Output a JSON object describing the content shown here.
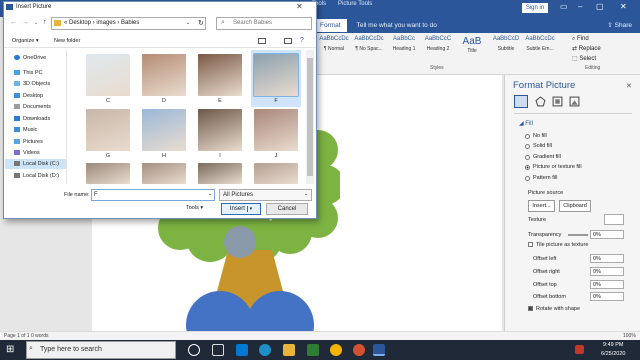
{
  "word": {
    "ribbon_tabs": [
      "Format",
      "Tell me what you want to do"
    ],
    "context_tools": [
      "Tools",
      "Picture Tools"
    ],
    "signin": "Sign in",
    "styles": [
      {
        "sample": "AaBbCcDc",
        "label": "¶ Normal"
      },
      {
        "sample": "AaBbCcDc",
        "label": "¶ No Spac..."
      },
      {
        "sample": "AaBbCc",
        "label": "Heading 1"
      },
      {
        "sample": "AaBbCcC",
        "label": "Heading 2"
      },
      {
        "sample": "AaB",
        "label": "Title"
      },
      {
        "sample": "AaBbCcD",
        "label": "Subtitle"
      },
      {
        "sample": "AaBbCcDc",
        "label": "Subtle Em..."
      }
    ],
    "styles_group": "Styles",
    "editing": [
      "Find",
      "Replace",
      "Select"
    ],
    "editing_group": "Editing",
    "status": "Page 1 of 1    0 words",
    "zoom": "100%"
  },
  "format_pane": {
    "title": "Format Picture",
    "fill_heading": "Fill",
    "fill_options": [
      {
        "label": "No fill",
        "selected": false
      },
      {
        "label": "Solid fill",
        "selected": false
      },
      {
        "label": "Gradient fill",
        "selected": false
      },
      {
        "label": "Picture or texture fill",
        "selected": true
      },
      {
        "label": "Pattern fill",
        "selected": false
      }
    ],
    "picture_source": "Picture source",
    "insert_btn": "Insert...",
    "clipboard_btn": "Clipboard",
    "texture": "Texture",
    "transparency": {
      "label": "Transparency",
      "value": "0%"
    },
    "tile_label": "Tile picture as texture",
    "offsets": [
      {
        "label": "Offset left",
        "value": "0%"
      },
      {
        "label": "Offset right",
        "value": "0%"
      },
      {
        "label": "Offset top",
        "value": "0%"
      },
      {
        "label": "Offset bottom",
        "value": "0%"
      }
    ],
    "rotate_label": "Rotate with shape"
  },
  "dialog": {
    "title": "Insert Picture",
    "breadcrumb": "«  Desktop  ›  images  ›  Babies",
    "search_placeholder": "Search Babies",
    "organize": "Organize ▾",
    "new_folder": "New folder",
    "nav_items": [
      "OneDrive",
      "This PC",
      "3D Objects",
      "Desktop",
      "Documents",
      "Downloads",
      "Music",
      "Pictures",
      "Videos",
      "Local Disk (C:)",
      "Local Disk (D:)"
    ],
    "thumbnails": [
      {
        "label": "C",
        "color": "#dfe8ee"
      },
      {
        "label": "D",
        "color": "#b58c74"
      },
      {
        "label": "E",
        "color": "#7b5a45"
      },
      {
        "label": "F",
        "color": "#8ba0ae",
        "selected": true
      },
      {
        "label": "G",
        "color": "#c8b6a8"
      },
      {
        "label": "H",
        "color": "#9ab8d8"
      },
      {
        "label": "I",
        "color": "#6d5848"
      },
      {
        "label": "J",
        "color": "#a8877a"
      },
      {
        "label": "",
        "color": "#9b8a7c"
      },
      {
        "label": "",
        "color": "#a58f82"
      },
      {
        "label": "",
        "color": "#7a6a5e"
      },
      {
        "label": "",
        "color": "#b49f92"
      }
    ],
    "file_name_label": "File name:",
    "file_name_value": "F",
    "filter": "All Pictures",
    "tools": "Tools ▾",
    "insert": "Insert",
    "cancel": "Cancel"
  },
  "taskbar": {
    "search_placeholder": "Type here to search",
    "time": "9:49 PM",
    "date": "6/25/2020"
  }
}
